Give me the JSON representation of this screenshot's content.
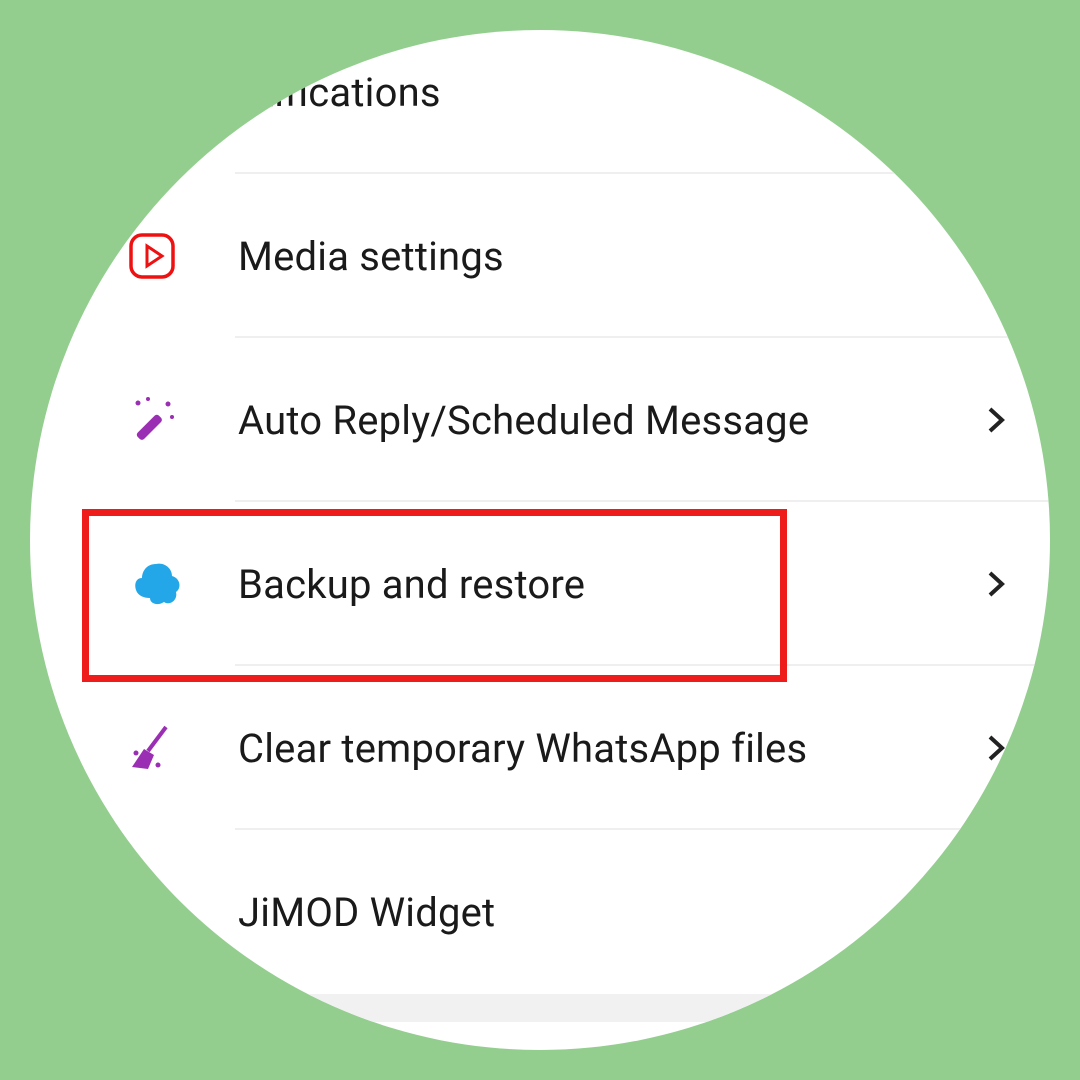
{
  "menu": {
    "notifications": {
      "label": "otifications"
    },
    "media": {
      "label": "Media settings"
    },
    "autoreply": {
      "label": "Auto Reply/Scheduled Message"
    },
    "backup": {
      "label": "Backup and restore"
    },
    "clear": {
      "label": "Clear temporary WhatsApp files"
    },
    "widget": {
      "label": "JiMOD Widget"
    }
  }
}
